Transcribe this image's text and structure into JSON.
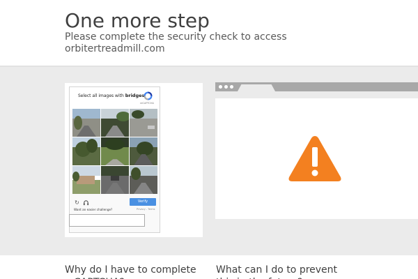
{
  "header": {
    "title": "One more step",
    "subtitle": "Please complete the security check to access orbitertreadmill.com"
  },
  "captcha": {
    "instruction_prefix": "Select all images with",
    "instruction_keyword": "bridges",
    "instruction_suffix": ".",
    "logo_text": "reCAPTCHA",
    "reload_icon": "reload-icon",
    "audio_icon": "headphones-icon",
    "verify_label": "Verify",
    "easier_text": "Want an easier challenge?",
    "privacy_text": "Privacy - Terms",
    "input_value": "",
    "tiles": [
      {
        "scene": "street-sky"
      },
      {
        "scene": "road-trees"
      },
      {
        "scene": "road-lot"
      },
      {
        "scene": "trees"
      },
      {
        "scene": "trees-grass"
      },
      {
        "scene": "trees-shadow"
      },
      {
        "scene": "building"
      },
      {
        "scene": "road-car"
      },
      {
        "scene": "road-street"
      }
    ]
  },
  "browser_mock": {
    "icon": "warning-icon",
    "icon_color": "#f38020"
  },
  "faq": {
    "left_question": "Why do I have to complete a CAPTCHA?",
    "right_question": "What can I do to prevent this in the future?"
  },
  "colors": {
    "warning": "#f38020",
    "verify_button": "#4a90e2",
    "band": "#ebebeb"
  }
}
